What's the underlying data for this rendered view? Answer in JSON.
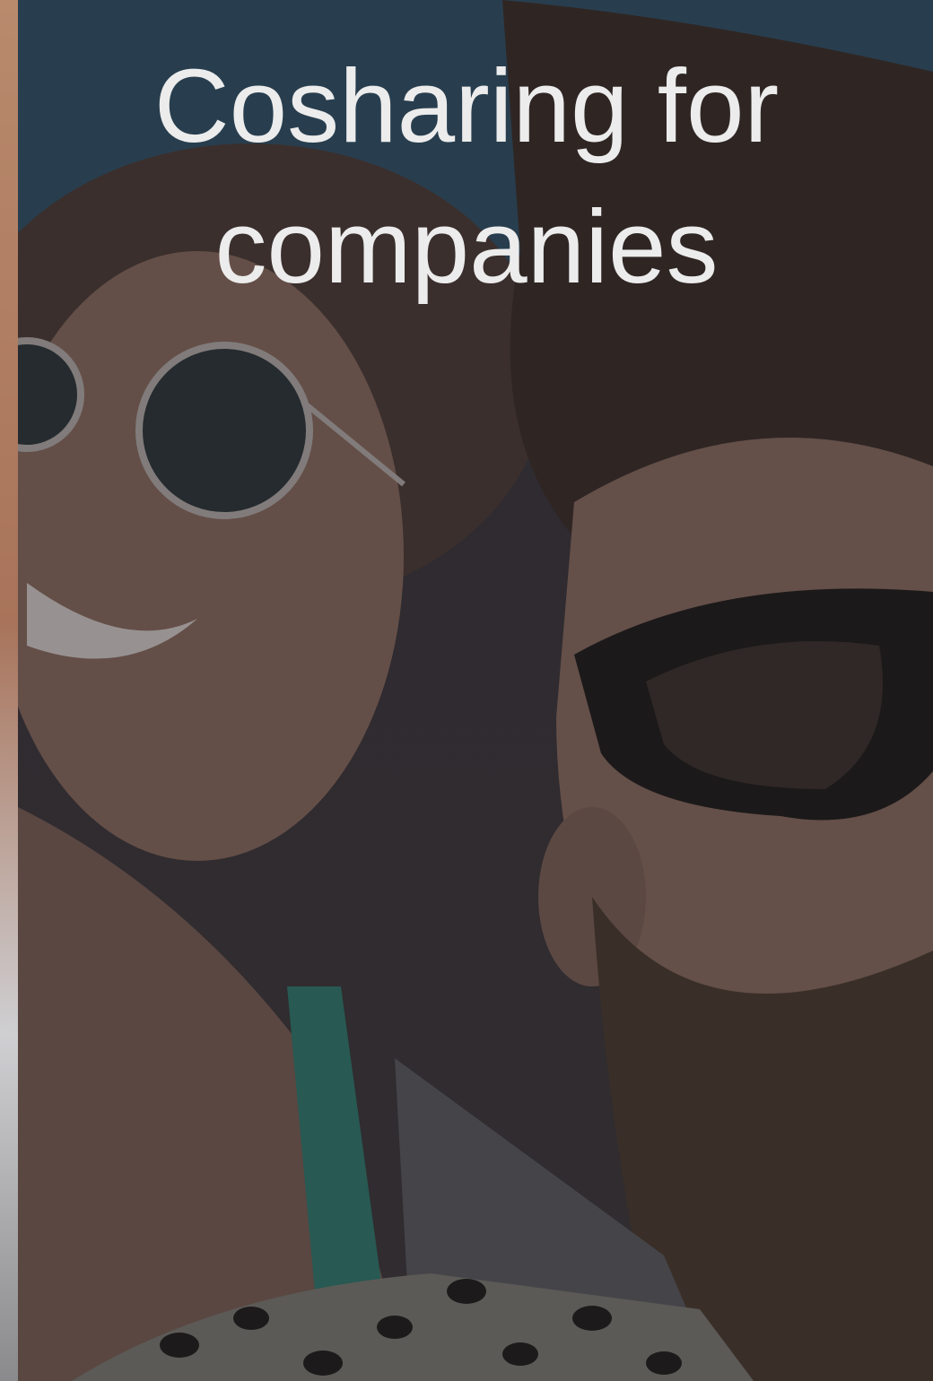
{
  "hero": {
    "headline": "Cosharing for companies",
    "background_image": "photo-two-people-in-sunglasses"
  },
  "colors": {
    "headline_text": "#ececec",
    "sky": "#2f4f63",
    "overlay": "#1e1e22"
  }
}
